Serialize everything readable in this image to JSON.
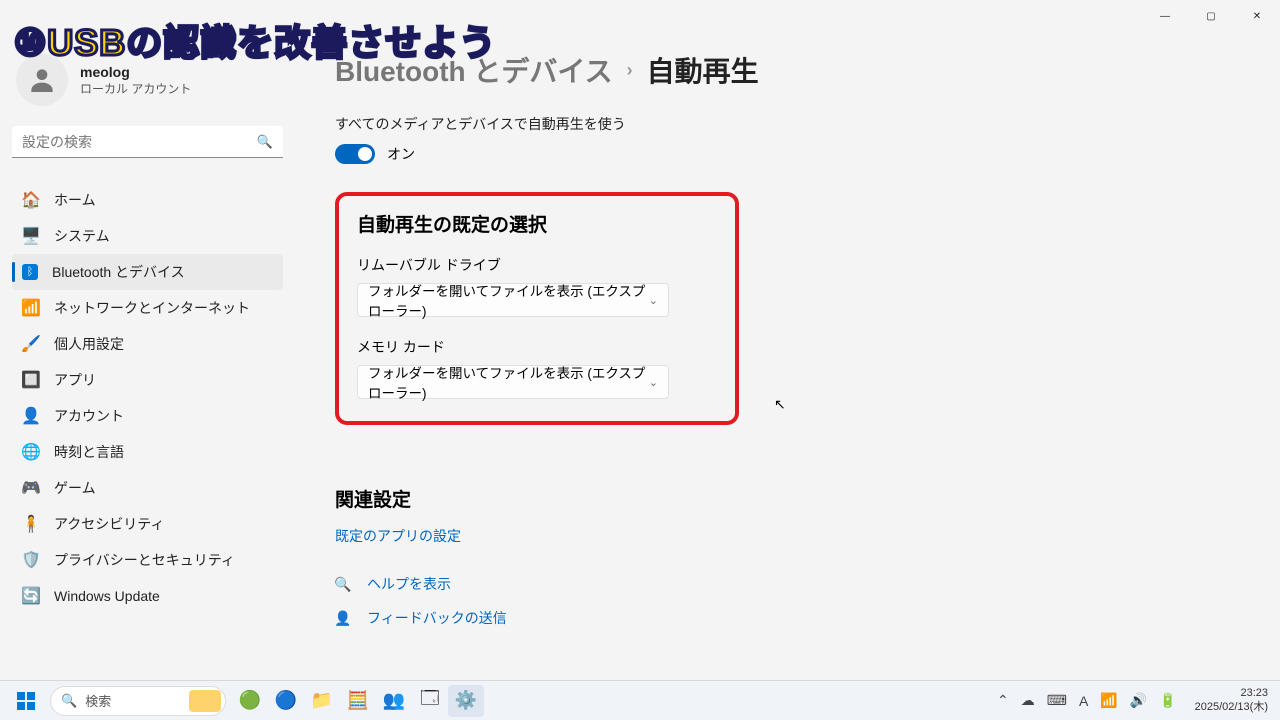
{
  "overlay": "⑩USBの認識を改善させよう",
  "window": {
    "min": "—",
    "max": "▢",
    "close": "✕"
  },
  "user": {
    "name": "meolog",
    "sub": "ローカル アカウント"
  },
  "search": {
    "placeholder": "設定の検索"
  },
  "nav": {
    "home": "ホーム",
    "system": "システム",
    "bluetooth": "Bluetooth とデバイス",
    "network": "ネットワークとインターネット",
    "personalize": "個人用設定",
    "apps": "アプリ",
    "accounts": "アカウント",
    "time": "時刻と言語",
    "gaming": "ゲーム",
    "accessibility": "アクセシビリティ",
    "privacy": "プライバシーとセキュリティ",
    "update": "Windows Update"
  },
  "breadcrumb": {
    "parent": "Bluetooth とデバイス",
    "sep": "›",
    "current": "自動再生"
  },
  "toggle": {
    "label": "すべてのメディアとデバイスで自動再生を使う",
    "state": "オン"
  },
  "defaults": {
    "title": "自動再生の既定の選択",
    "removable_label": "リムーバブル ドライブ",
    "removable_value": "フォルダーを開いてファイルを表示 (エクスプローラー)",
    "memory_label": "メモリ カード",
    "memory_value": "フォルダーを開いてファイルを表示 (エクスプローラー)"
  },
  "related": {
    "title": "関連設定",
    "link": "既定のアプリの設定"
  },
  "help": {
    "show": "ヘルプを表示",
    "feedback": "フィードバックの送信"
  },
  "taskbar": {
    "search": "検索"
  },
  "clock": {
    "time": "23:23",
    "date": "2025/02/13(木)"
  }
}
